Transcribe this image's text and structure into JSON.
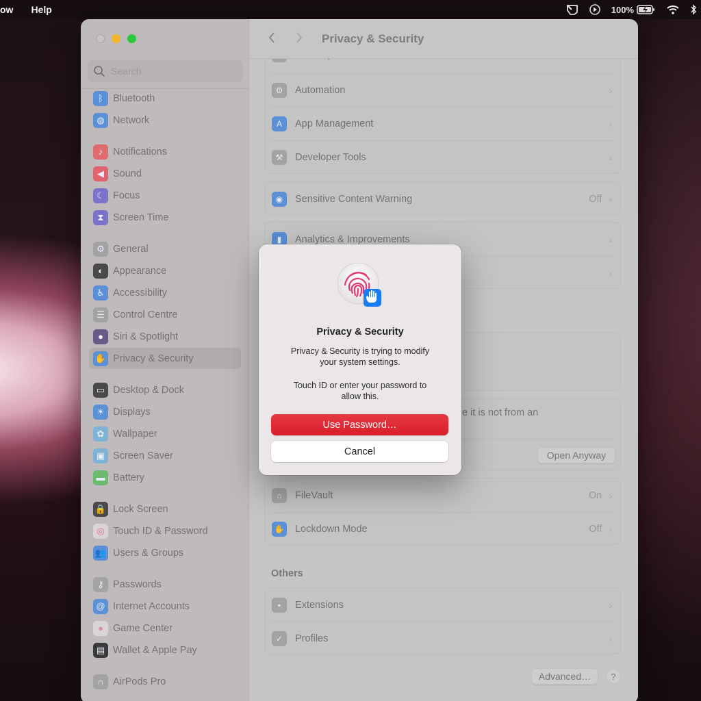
{
  "menubar": {
    "left_items": [
      "ow",
      "Help"
    ],
    "battery_percent": "100%",
    "status_icons": [
      "screen-mirror-icon",
      "play-icon",
      "battery-charging-icon",
      "wifi-icon",
      "bluetooth-icon"
    ]
  },
  "window": {
    "search_placeholder": "Search",
    "sidebar": {
      "items": [
        {
          "label": "Bluetooth",
          "icon": "bluetooth-icon",
          "color": "#5b8fd6"
        },
        {
          "label": "Network",
          "icon": "globe-icon",
          "color": "#5b8fd6"
        },
        {
          "label": "Notifications",
          "icon": "bell-icon",
          "color": "#e06b6e"
        },
        {
          "label": "Sound",
          "icon": "speaker-icon",
          "color": "#e0646f"
        },
        {
          "label": "Focus",
          "icon": "moon-icon",
          "color": "#7b72c9"
        },
        {
          "label": "Screen Time",
          "icon": "hourglass-icon",
          "color": "#7b72c9"
        },
        {
          "label": "General",
          "icon": "gear-icon",
          "color": "#a3a3a3"
        },
        {
          "label": "Appearance",
          "icon": "appearance-icon",
          "color": "#4a4a4a"
        },
        {
          "label": "Accessibility",
          "icon": "accessibility-icon",
          "color": "#5b8fd6"
        },
        {
          "label": "Control Centre",
          "icon": "toggles-icon",
          "color": "#a3a3a3"
        },
        {
          "label": "Siri & Spotlight",
          "icon": "siri-icon",
          "color": "#6a5a8a"
        },
        {
          "label": "Privacy & Security",
          "icon": "hand-icon",
          "color": "#5b8fd6",
          "selected": true
        },
        {
          "label": "Desktop & Dock",
          "icon": "dock-icon",
          "color": "#4a4a4a"
        },
        {
          "label": "Displays",
          "icon": "sun-icon",
          "color": "#5b8fd6"
        },
        {
          "label": "Wallpaper",
          "icon": "flower-icon",
          "color": "#7fb3d6"
        },
        {
          "label": "Screen Saver",
          "icon": "screensaver-icon",
          "color": "#7fb3d6"
        },
        {
          "label": "Battery",
          "icon": "battery-icon",
          "color": "#6bba6e"
        },
        {
          "label": "Lock Screen",
          "icon": "lock-icon",
          "color": "#4a4a4a"
        },
        {
          "label": "Touch ID & Password",
          "icon": "fingerprint-icon",
          "color": "#d9d5d6"
        },
        {
          "label": "Users & Groups",
          "icon": "users-icon",
          "color": "#5b8fd6"
        },
        {
          "label": "Passwords",
          "icon": "key-icon",
          "color": "#a3a3a3"
        },
        {
          "label": "Internet Accounts",
          "icon": "at-icon",
          "color": "#5b8fd6"
        },
        {
          "label": "Game Center",
          "icon": "game-center-icon",
          "color": "#d9d5d6"
        },
        {
          "label": "Wallet & Apple Pay",
          "icon": "wallet-icon",
          "color": "#3a3a3a"
        },
        {
          "label": "AirPods Pro",
          "icon": "airpods-icon",
          "color": "#a3a3a3"
        }
      ]
    },
    "main": {
      "title": "Privacy & Security",
      "partial_row_label": "Passkeys Access for Web Browsers",
      "group1": [
        {
          "label": "Automation",
          "icon": "gears-icon",
          "color": "#a3a3a3"
        },
        {
          "label": "App Management",
          "icon": "app-store-icon",
          "color": "#5b8fd6"
        },
        {
          "label": "Developer Tools",
          "icon": "hammer-icon",
          "color": "#a3a3a3"
        }
      ],
      "group2": [
        {
          "label": "Sensitive Content Warning",
          "value": "Off",
          "icon": "eye-warning-icon",
          "color": "#5b8fd6"
        }
      ],
      "group3": [
        {
          "label": "Analytics & Improvements",
          "icon": "chart-icon",
          "color": "#5b8fd6"
        }
      ],
      "security_text_fragment": "e it is not from an",
      "open_anyway_label": "Open Anyway",
      "group4": [
        {
          "label": "FileVault",
          "value": "On",
          "icon": "house-lock-icon",
          "color": "#a3a3a3"
        },
        {
          "label": "Lockdown Mode",
          "value": "Off",
          "icon": "hand-icon",
          "color": "#5b8fd6"
        }
      ],
      "others_heading": "Others",
      "others": [
        {
          "label": "Extensions",
          "icon": "puzzle-icon",
          "color": "#a3a3a3"
        },
        {
          "label": "Profiles",
          "icon": "badge-check-icon",
          "color": "#a3a3a3"
        }
      ],
      "advanced_label": "Advanced…",
      "help_label": "?"
    }
  },
  "dialog": {
    "title": "Privacy & Security",
    "message_line1": "Privacy & Security is trying to modify",
    "message_line2": "your system settings.",
    "message_line3": "Touch ID or enter your password to",
    "message_line4": "allow this.",
    "primary_label": "Use Password…",
    "cancel_label": "Cancel",
    "accent_color": "#df2530"
  }
}
